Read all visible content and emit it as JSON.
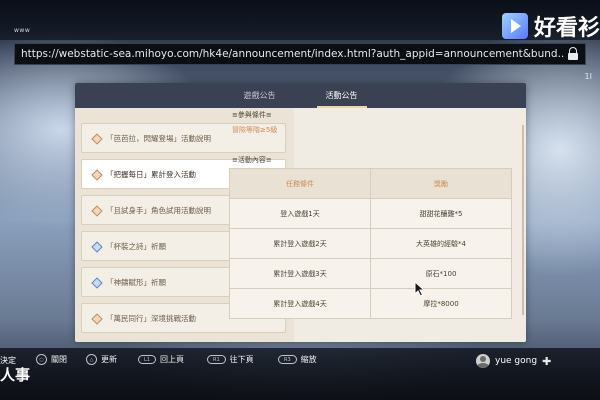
{
  "browser": {
    "www_label": "www",
    "url": "https://webstatic-sea.mihoyo.com/hk4e/announcement/index.html?auth_appid=announcement&bund...",
    "side_mark": "1I"
  },
  "watermark": {
    "text": "好看衫"
  },
  "tabs": [
    {
      "label": "遊戲公告",
      "active": false
    },
    {
      "label": "活動公告",
      "active": true
    }
  ],
  "sidebar": {
    "items": [
      {
        "label": "「芭芭拉，閃耀登場」活動說明",
        "icon": "diamond-icon"
      },
      {
        "label": "「把握每日」累計登入活動",
        "icon": "diamond-icon",
        "active": true
      },
      {
        "label": "「且試身手」角色試用活動說明",
        "icon": "diamond-icon"
      },
      {
        "label": "「杯裝之詩」祈願",
        "icon": "blue-diamond-icon"
      },
      {
        "label": "「神鑄賦形」祈願",
        "icon": "blue-diamond-icon"
      },
      {
        "label": "「萬民同行」深境挑戰活動",
        "icon": "diamond-icon"
      }
    ]
  },
  "content": {
    "requirement_title": "≡參與條件≡",
    "requirement_value": "冒險等階≥5級",
    "details_title": "≡活動內容≡",
    "table": {
      "headers": [
        "任務條件",
        "獎勵"
      ],
      "rows": [
        [
          "登入遊戲1天",
          "甜甜花釀雞*5"
        ],
        [
          "累計登入遊戲2天",
          "大英雄的經驗*4"
        ],
        [
          "累計登入遊戲3天",
          "原石*100"
        ],
        [
          "累計登入遊戲4天",
          "摩拉*8000"
        ]
      ]
    }
  },
  "controls": {
    "left_cut": "決定",
    "close_btn": "○",
    "close_label": "關閉",
    "refresh_btn": "△",
    "refresh_label": "更新",
    "pageup_btn": "L1",
    "pageup_label": "回上頁",
    "pagedown_btn": "R1",
    "pagedown_label": "往下頁",
    "zoom_btn": "R3",
    "zoom_label": "縮放"
  },
  "subtitle": "人事",
  "user": {
    "name": "yue gong",
    "plus": "✚"
  },
  "colors": {
    "accent": "#d08a5a",
    "panel_bg": "#eae3d6",
    "header_bg": "#3a4152"
  }
}
